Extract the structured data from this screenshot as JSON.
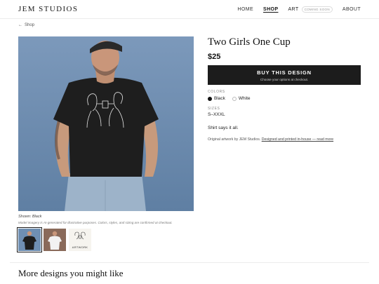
{
  "header": {
    "brand": "JEM STUDIOS",
    "nav": {
      "home": "HOME",
      "shop": "SHOP",
      "art": "ART",
      "art_badge": "COMING SOON",
      "about": "ABOUT"
    }
  },
  "back_link": {
    "arrow": "←",
    "label": "Shop"
  },
  "gallery": {
    "caption": "Shown: Black",
    "note": "Model imagery is AI-generated for illustrative purposes. Colors, styles, and sizing are confirmed at checkout.",
    "thumbnails": [
      {
        "label": ""
      },
      {
        "label": ""
      },
      {
        "label": "ARTWORK"
      }
    ]
  },
  "product": {
    "title": "Two Girls One Cup",
    "price": "$25",
    "buy_label": "BUY THIS DESIGN",
    "buy_sub": "Choose your options at checkout.",
    "colors_label": "COLORS",
    "colors": [
      "Black",
      "White"
    ],
    "sizes_label": "SIZES",
    "sizes_value": "S–XXXL",
    "description": "Shirt says it all.",
    "origin_text": "Original artwork by JEM Studios.",
    "origin_link": "Designed and printed in-house — read more"
  },
  "more_section": {
    "heading": "More designs you might like"
  },
  "colors_theme": {
    "background_blue": "#6f8fb3",
    "button_dark": "#1c1c1c",
    "thumb2_bg": "#8a6a5a"
  }
}
